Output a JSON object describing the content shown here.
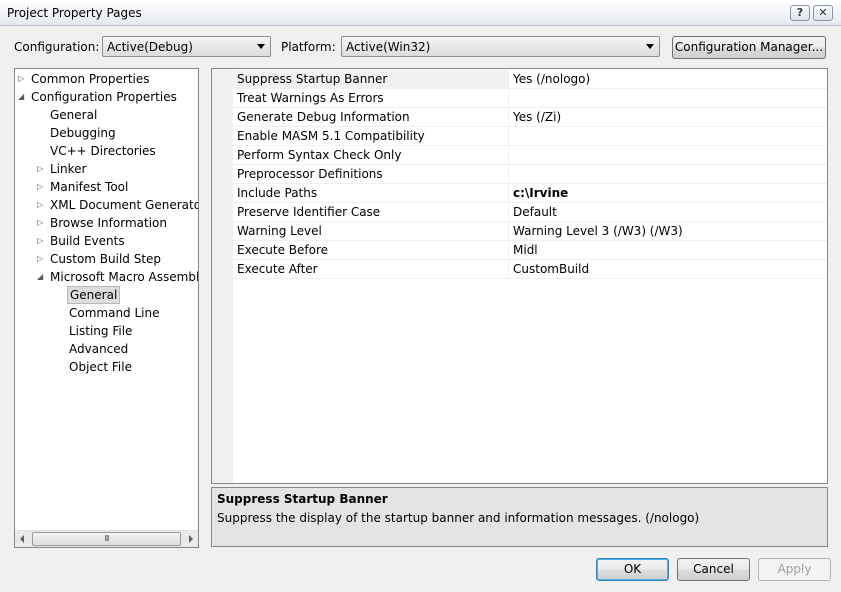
{
  "window": {
    "title": "Project Property Pages",
    "help_glyph": "?",
    "close_glyph": "✕"
  },
  "toolbar": {
    "configuration_label": "Configuration:",
    "configuration_value": "Active(Debug)",
    "platform_label": "Platform:",
    "platform_value": "Active(Win32)",
    "config_manager_label": "Configuration Manager..."
  },
  "tree": {
    "items": [
      {
        "label": "Common Properties",
        "expander": "▷"
      },
      {
        "label": "Configuration Properties",
        "expander": "◢"
      },
      {
        "label": "General",
        "expander": ""
      },
      {
        "label": "Debugging",
        "expander": ""
      },
      {
        "label": "VC++ Directories",
        "expander": ""
      },
      {
        "label": "Linker",
        "expander": "▷"
      },
      {
        "label": "Manifest Tool",
        "expander": "▷"
      },
      {
        "label": "XML Document Generator",
        "expander": "▷"
      },
      {
        "label": "Browse Information",
        "expander": "▷"
      },
      {
        "label": "Build Events",
        "expander": "▷"
      },
      {
        "label": "Custom Build Step",
        "expander": "▷"
      },
      {
        "label": "Microsoft Macro Assembler",
        "expander": "◢"
      },
      {
        "label": "General",
        "expander": ""
      },
      {
        "label": "Command Line",
        "expander": ""
      },
      {
        "label": "Listing File",
        "expander": ""
      },
      {
        "label": "Advanced",
        "expander": ""
      },
      {
        "label": "Object File",
        "expander": ""
      }
    ],
    "selected_index": 12,
    "scroll_thumb_grip": "III"
  },
  "properties": [
    {
      "name": "Suppress Startup Banner",
      "value": "Yes (/nologo)",
      "bold": false
    },
    {
      "name": "Treat Warnings As Errors",
      "value": "",
      "bold": false
    },
    {
      "name": "Generate Debug Information",
      "value": "Yes (/Zi)",
      "bold": false
    },
    {
      "name": "Enable MASM 5.1 Compatibility",
      "value": "",
      "bold": false
    },
    {
      "name": "Perform Syntax Check Only",
      "value": "",
      "bold": false
    },
    {
      "name": "Preprocessor Definitions",
      "value": "",
      "bold": false
    },
    {
      "name": "Include Paths",
      "value": "c:\\Irvine",
      "bold": true
    },
    {
      "name": "Preserve Identifier Case",
      "value": "Default",
      "bold": false
    },
    {
      "name": "Warning Level",
      "value": "Warning Level 3 (/W3) (/W3)",
      "bold": false
    },
    {
      "name": "Execute Before",
      "value": "Midl",
      "bold": false
    },
    {
      "name": "Execute After",
      "value": "CustomBuild",
      "bold": false
    }
  ],
  "selected_property_index": 0,
  "description": {
    "title": "Suppress Startup Banner",
    "text": "Suppress the display of the startup banner and information messages.     (/nologo)"
  },
  "buttons": {
    "ok": "OK",
    "cancel": "Cancel",
    "apply": "Apply"
  }
}
